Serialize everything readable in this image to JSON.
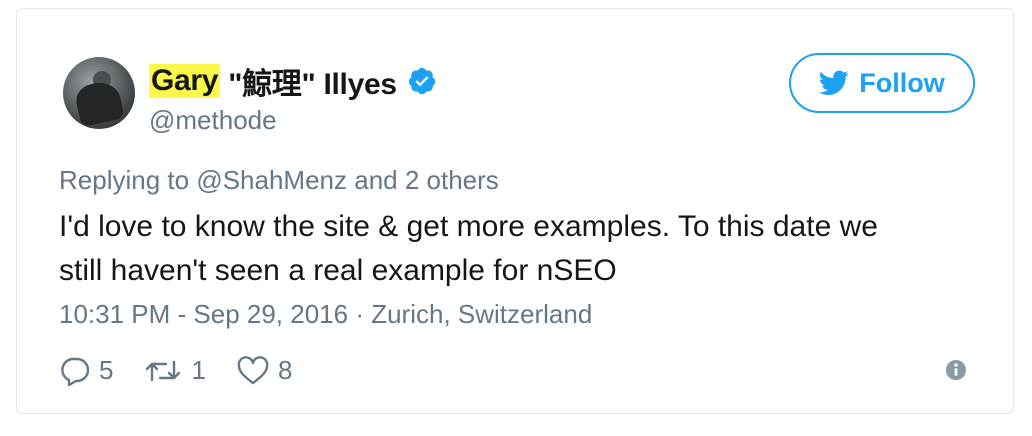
{
  "tweet": {
    "author": {
      "first_name": "Gary",
      "rest_of_name": "\"鯨理\" Illyes",
      "handle": "@methode"
    },
    "follow_label": "Follow",
    "reply": {
      "prefix": "Replying to ",
      "target": "@ShahMenz",
      "suffix": " and 2 others"
    },
    "text_line1": "I'd love to know the site & get more examples. To this date we",
    "text_line2": "still haven't seen a real example for nSEO",
    "meta": {
      "time": "10:31 PM - Sep 29, 2016",
      "separator": " · ",
      "location": "Zurich, Switzerland"
    },
    "stats": {
      "replies": "5",
      "retweets": "1",
      "likes": "8"
    }
  },
  "colors": {
    "accent": "#1da1f2",
    "muted": "#657786",
    "highlight": "#fbf84a",
    "text": "#14171a",
    "border": "#e1e8ed"
  },
  "icons": [
    "verified-badge-icon",
    "twitter-bird-icon",
    "reply-icon",
    "retweet-icon",
    "like-icon",
    "info-icon"
  ]
}
